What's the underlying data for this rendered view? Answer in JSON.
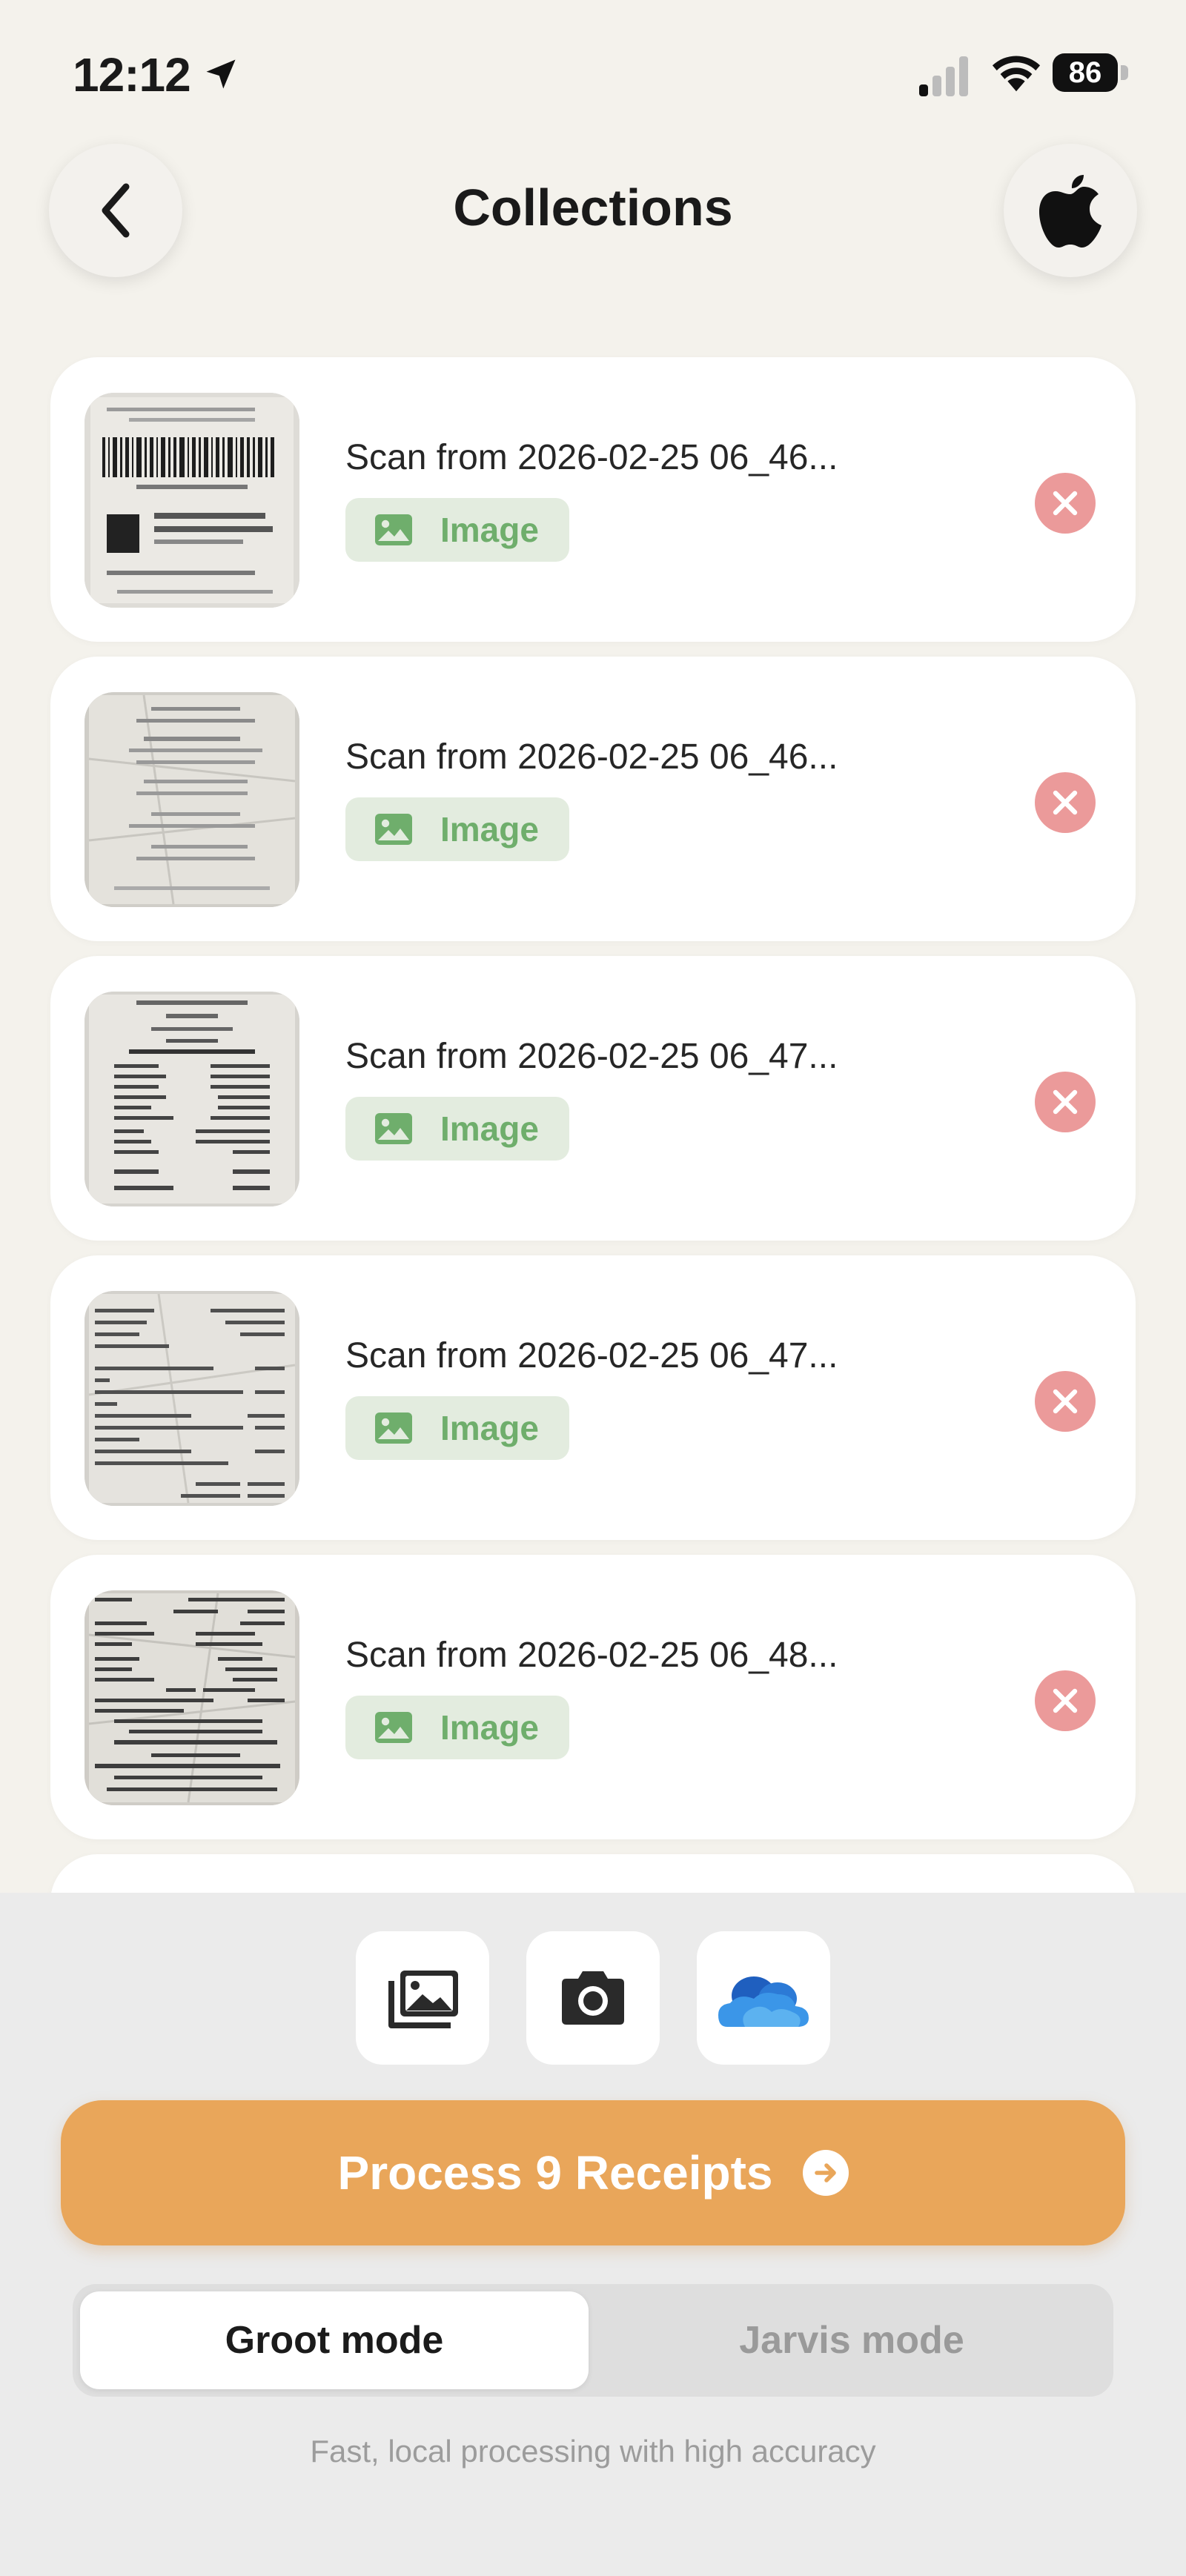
{
  "status_bar": {
    "time": "12:12",
    "battery": "86"
  },
  "header": {
    "title": "Collections"
  },
  "items": [
    {
      "title": "Scan from 2026-02-25 06_46...",
      "badge": "Image"
    },
    {
      "title": "Scan from 2026-02-25 06_46...",
      "badge": "Image"
    },
    {
      "title": "Scan from 2026-02-25 06_47...",
      "badge": "Image"
    },
    {
      "title": "Scan from 2026-02-25 06_47...",
      "badge": "Image"
    },
    {
      "title": "Scan from 2026-02-25 06_48...",
      "badge": "Image"
    }
  ],
  "sources": [
    "gallery-icon",
    "camera-icon",
    "onedrive-icon"
  ],
  "actions": {
    "process_label": "Process 9 Receipts"
  },
  "modes": {
    "active": "Groot mode",
    "inactive": "Jarvis mode",
    "description": "Fast, local processing with high accuracy"
  },
  "colors": {
    "accent": "#e9a65a",
    "badge_bg": "#e3ecdf",
    "badge_text": "#6fae6c",
    "remove": "#eb9a9a",
    "background": "#f4f2ec"
  }
}
